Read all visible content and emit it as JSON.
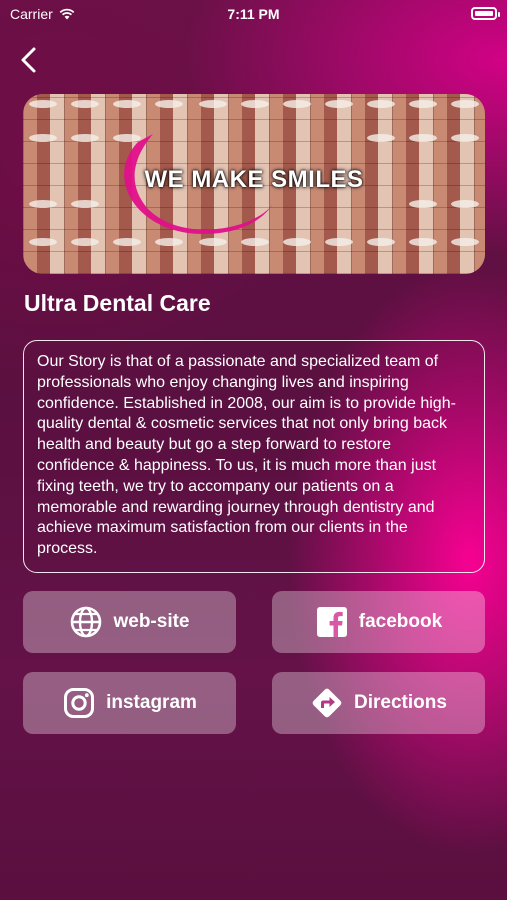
{
  "status_bar": {
    "carrier": "Carrier",
    "time": "7:11 PM"
  },
  "nav": {
    "back_icon": "chevron-left-icon"
  },
  "banner": {
    "title": "WE MAKE SMILES",
    "accent_color": "#e0108a"
  },
  "clinic": {
    "name": "Ultra Dental Care",
    "story": "Our Story is that of a passionate and specialized team of professionals who enjoy changing lives and inspiring confidence. Established in 2008, our aim is to provide high-quality dental & cosmetic services that not only bring back health and beauty but go a step forward to restore confidence & happiness. To us, it is much more than just fixing teeth, we try to accompany our patients on a memorable and rewarding journey through dentistry and achieve maximum satisfaction from our clients in the process."
  },
  "actions": {
    "website": {
      "label": "web-site",
      "icon": "globe-icon"
    },
    "facebook": {
      "label": "facebook",
      "icon": "facebook-icon"
    },
    "instagram": {
      "label": "instagram",
      "icon": "instagram-icon"
    },
    "directions": {
      "label": "Directions",
      "icon": "directions-icon"
    }
  }
}
